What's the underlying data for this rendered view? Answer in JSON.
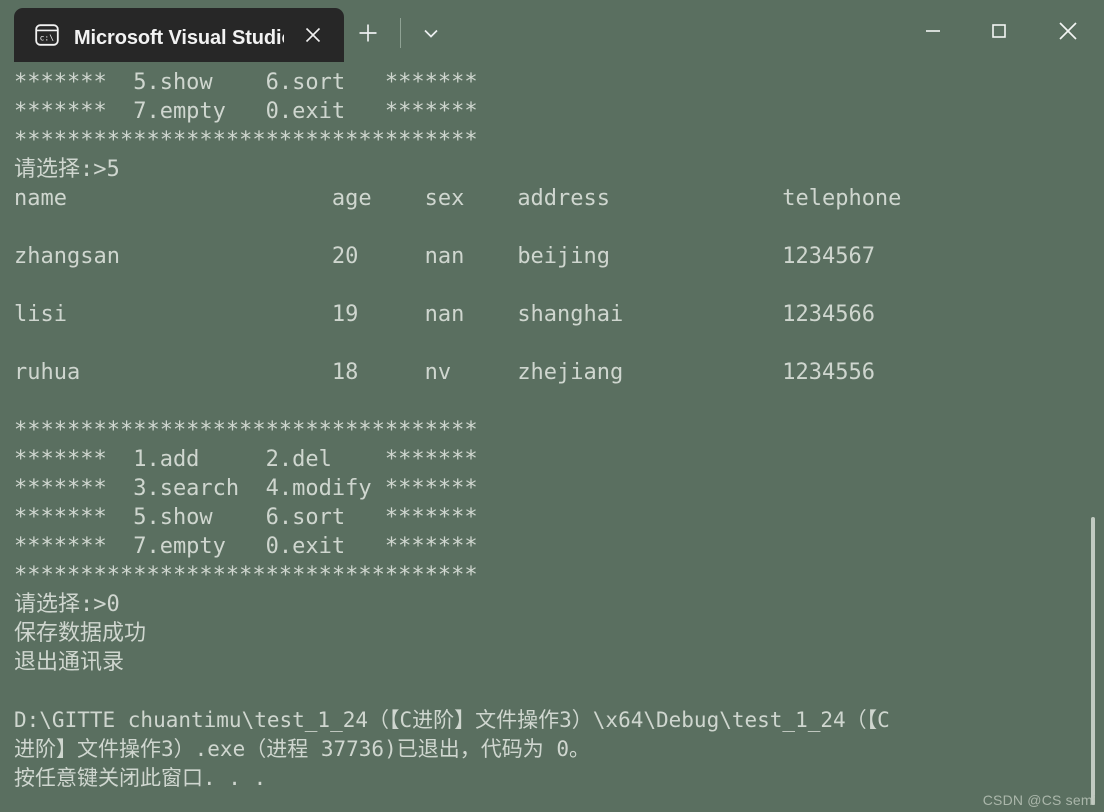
{
  "window": {
    "tab": {
      "title": "Microsoft Visual Studio 调试控",
      "icon": "console-cmd-icon",
      "close_label": "✕"
    },
    "new_tab_label": "+",
    "dropdown_label": "chevron-down",
    "controls": {
      "minimize": "minimize-icon",
      "maximize": "maximize-icon",
      "close": "close-icon"
    },
    "colors": {
      "terminal_background": "#5a6f60",
      "terminal_foreground": "#cfd6cf",
      "tab_background": "#272727",
      "tab_foreground": "#f2f2f2"
    }
  },
  "terminal": {
    "lines": [
      "*******  5.show    6.sort   *******",
      "*******  7.empty   0.exit   *******",
      "***********************************",
      "请选择:>5",
      "name                    age    sex    address             telephone",
      "",
      "zhangsan                20     nan    beijing             1234567",
      "",
      "lisi                    19     nan    shanghai            1234566",
      "",
      "ruhua                   18     nv     zhejiang            1234556",
      "",
      "***********************************",
      "*******  1.add     2.del    *******",
      "*******  3.search  4.modify *******",
      "*******  5.show    6.sort   *******",
      "*******  7.empty   0.exit   *******",
      "***********************************",
      "请选择:>0",
      "保存数据成功",
      "退出通讯录",
      ""
    ],
    "tail_lines": [
      "D:\\GITTE chuantimu\\test_1_24（【C进阶】文件操作3）\\x64\\Debug\\test_1_24（【C",
      "进阶】文件操作3）.exe（进程 37736)已退出，代码为 0。",
      "按任意键关闭此窗口. . ."
    ],
    "scrollbar": {
      "name": "vertical-scrollbar"
    }
  },
  "watermark": {
    "text": "CSDN @CS semi"
  }
}
